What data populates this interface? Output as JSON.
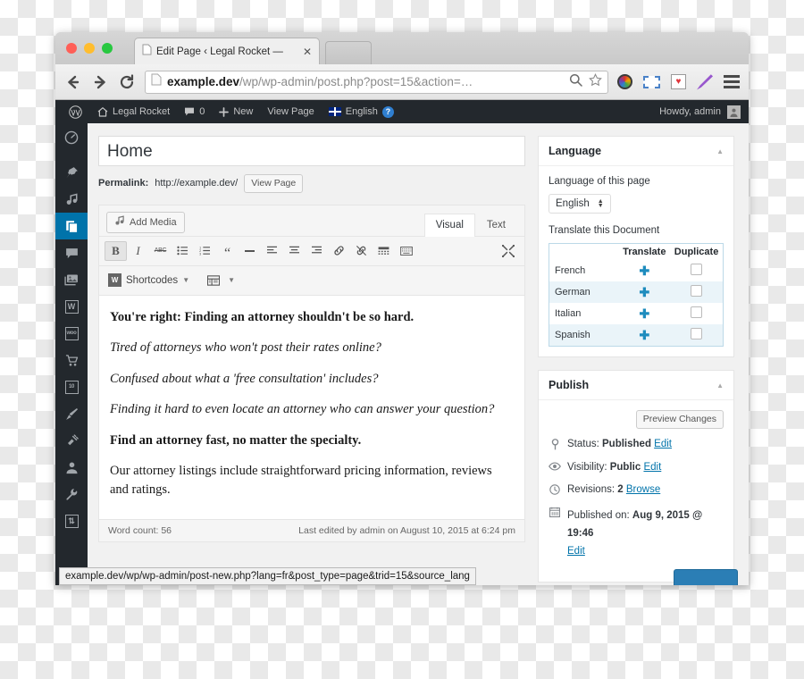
{
  "browser": {
    "tab": {
      "title": "Edit Page ‹ Legal Rocket —",
      "close": "✕"
    },
    "nav": {
      "back": "back-arrow",
      "forward": "forward-arrow",
      "reload": "reload-arrow"
    },
    "url": {
      "domain": "example.dev",
      "path": "/wp/wp-admin/post.php?post=15&action=…"
    },
    "statusbar": "example.dev/wp/wp-admin/post-new.php?lang=fr&post_type=page&trid=15&source_lang",
    "extensions": [
      "color-wheel-icon",
      "screenshot-icon",
      "heart-bookmark-icon",
      "pen-icon",
      "menu-icon"
    ]
  },
  "adminbar": {
    "logo": "Ⓦ",
    "site": "Legal Rocket",
    "comments_count": "0",
    "new": "New",
    "view_page": "View Page",
    "language": "English",
    "help": "?",
    "howdy": "Howdy, admin"
  },
  "adminmenu": {
    "items": [
      {
        "name": "dashboard",
        "glyph": "◔"
      },
      {
        "name": "posts",
        "glyph": "📌"
      },
      {
        "name": "media",
        "glyph": "♪"
      },
      {
        "name": "pages",
        "glyph": "❐",
        "active": true
      },
      {
        "name": "comments",
        "glyph": "💬"
      },
      {
        "name": "gallery",
        "glyph": "🖼"
      },
      {
        "name": "wpml",
        "glyph": "W"
      },
      {
        "name": "woocommerce",
        "glyph": "woo"
      },
      {
        "name": "products",
        "glyph": "🛒"
      },
      {
        "name": "events",
        "glyph": "10"
      },
      {
        "name": "appearance",
        "glyph": "🖌"
      },
      {
        "name": "plugins",
        "glyph": "🔌"
      },
      {
        "name": "users",
        "glyph": "👤"
      },
      {
        "name": "tools",
        "glyph": "🔧"
      },
      {
        "name": "settings",
        "glyph": "⇅"
      }
    ]
  },
  "editor": {
    "title": "Home",
    "permalink_label": "Permalink:",
    "permalink_url": "http://example.dev/",
    "view_page_button": "View Page",
    "add_media": "Add Media",
    "tab_visual": "Visual",
    "tab_text": "Text",
    "shortcodes": "Shortcodes",
    "toolbar_buttons": [
      "bold",
      "italic",
      "strikethrough",
      "bullet-list",
      "numbered-list",
      "blockquote",
      "horizontal-rule",
      "align-left",
      "align-center",
      "align-right",
      "link",
      "unlink",
      "read-more",
      "keyboard-shortcuts",
      "fullscreen"
    ],
    "paragraphs": [
      {
        "style": "b",
        "text": "You're right: Finding an attorney shouldn't be so hard."
      },
      {
        "style": "i",
        "text": "Tired of attorneys who won't post their rates online?"
      },
      {
        "style": "i",
        "text": "Confused about what a 'free consultation' includes?"
      },
      {
        "style": "i",
        "text": "Finding it hard to even locate an attorney who can answer your question?"
      },
      {
        "style": "b",
        "text": "Find an attorney fast, no matter the specialty."
      },
      {
        "style": "",
        "text": "Our attorney listings include straightforward pricing information, reviews and ratings."
      }
    ],
    "word_count": "Word count: 56",
    "last_edited": "Last edited by admin on August 10, 2015 at 6:24 pm"
  },
  "language_box": {
    "title": "Language",
    "lang_label": "Language of this page",
    "lang_value": "English",
    "translate_label": "Translate this Document",
    "col_translate": "Translate",
    "col_duplicate": "Duplicate",
    "rows": [
      {
        "language": "French",
        "translate": "✚",
        "duplicate": ""
      },
      {
        "language": "German",
        "translate": "✚",
        "duplicate": ""
      },
      {
        "language": "Italian",
        "translate": "✚",
        "duplicate": ""
      },
      {
        "language": "Spanish",
        "translate": "✚",
        "duplicate": ""
      }
    ]
  },
  "publish_box": {
    "title": "Publish",
    "preview_button": "Preview Changes",
    "status_label": "Status:",
    "status_value": "Published",
    "status_edit": "Edit",
    "visibility_label": "Visibility:",
    "visibility_value": "Public",
    "visibility_edit": "Edit",
    "revisions_label": "Revisions:",
    "revisions_value": "2",
    "revisions_browse": "Browse",
    "published_label": "Published on:",
    "published_value": "Aug 9, 2015 @ 19:46",
    "published_edit": "Edit"
  },
  "colors": {
    "wp_dark": "#23282d",
    "wp_blue": "#0073aa",
    "link_blue": "#0073aa",
    "plus_blue": "#1e8cbe"
  }
}
